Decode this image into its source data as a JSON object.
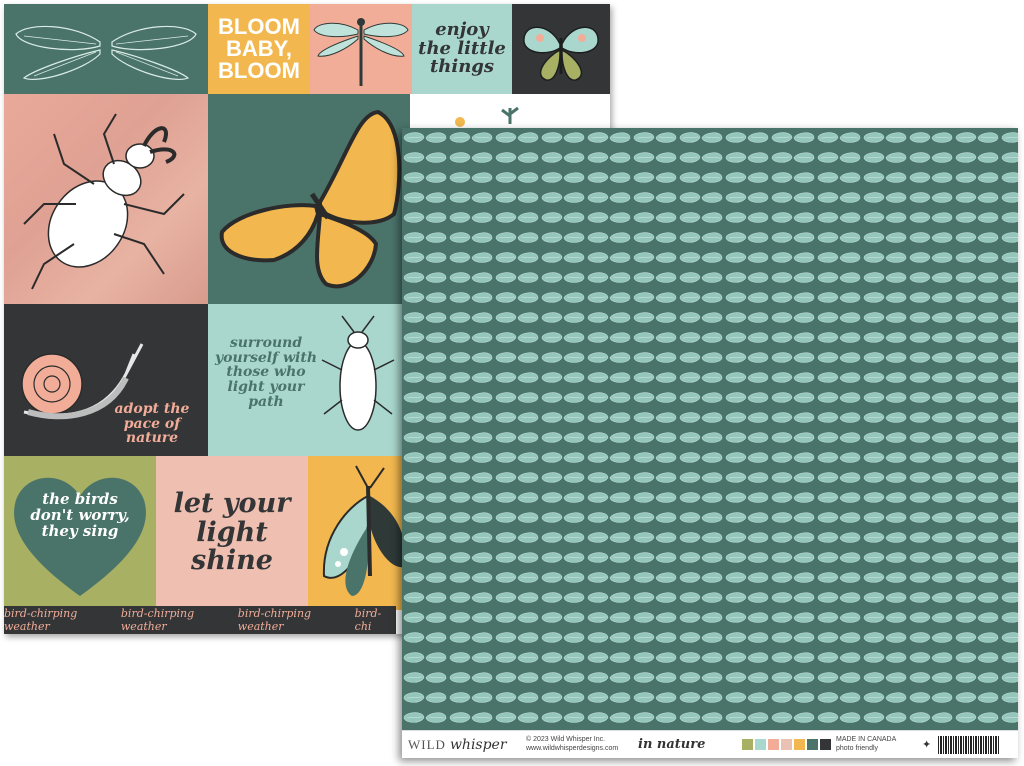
{
  "tiles": {
    "bloom": "BLOOM BABY, BLOOM",
    "enjoy": "enjoy the little things",
    "adopt": "adopt the pace of nature",
    "surround": "surround yourself with those who light your path",
    "birds": "the birds don't worry, they sing",
    "shine": "let your light shine"
  },
  "strip": {
    "items": [
      "bird-chirping weather",
      "bird-chirping weather",
      "bird-chirping weather",
      "bird-chi"
    ]
  },
  "footer": {
    "brand_wild": "WILD",
    "brand_whisper": "whisper",
    "copyright": "© 2023 Wild Whisper Inc.",
    "website": "www.wildwhisperdesigns.com",
    "collection": "in nature",
    "made_in": "MADE IN CANADA",
    "photo": "photo friendly"
  },
  "colors": {
    "teal": "#4a736a",
    "yellow": "#f2b84f",
    "peach": "#f2ad99",
    "mint": "#a9d7cd",
    "charcoal": "#333536",
    "olive": "#a8b064",
    "swatches": [
      "#a8b064",
      "#a9d7cd",
      "#f2ad99",
      "#e9c2b4",
      "#f2b84f",
      "#4a736a",
      "#333536"
    ]
  }
}
